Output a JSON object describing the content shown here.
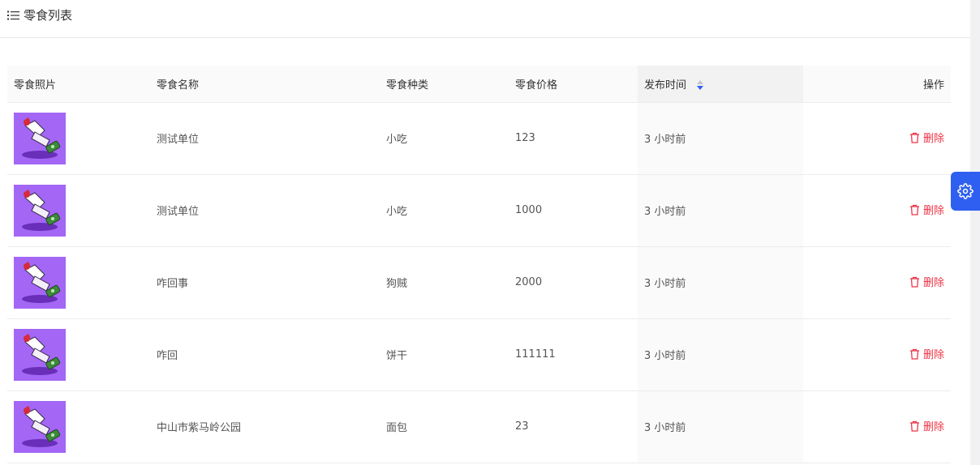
{
  "header": {
    "title": "零食列表",
    "icon": "list-icon"
  },
  "table": {
    "columns": {
      "photo": "零食照片",
      "name": "零食名称",
      "category": "零食种类",
      "price": "零食价格",
      "published": "发布时间",
      "actions": "操作"
    },
    "sorted_column": "published",
    "rows": [
      {
        "name": "测试单位",
        "category": "小吃",
        "price": "123",
        "published": "3 小时前",
        "delete_label": "删除"
      },
      {
        "name": "测试单位",
        "category": "小吃",
        "price": "1000",
        "published": "3 小时前",
        "delete_label": "删除"
      },
      {
        "name": "咋回事",
        "category": "狗贼",
        "price": "2000",
        "published": "3 小时前",
        "delete_label": "删除"
      },
      {
        "name": "咋回",
        "category": "饼干",
        "price": "111111",
        "published": "3 小时前",
        "delete_label": "删除"
      },
      {
        "name": "中山市紫马岭公园",
        "category": "面包",
        "price": "23",
        "published": "3 小时前",
        "delete_label": "删除"
      }
    ]
  },
  "colors": {
    "accent": "#2f5ff0",
    "danger": "#ee3344",
    "thumb_bg": "#a366f5"
  },
  "side_button": {
    "icon": "gear-icon"
  }
}
